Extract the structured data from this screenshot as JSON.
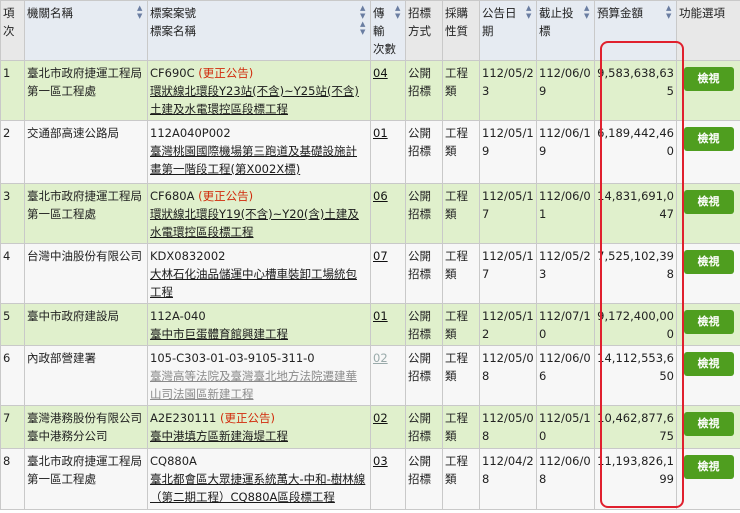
{
  "headers": {
    "idx": "項次",
    "agency": "機關名稱",
    "case_line1": "標案案號",
    "case_line2": "標案名稱",
    "freq": "傳輸次數",
    "method": "招標方式",
    "category": "採購性質",
    "announce": "公告日期",
    "deadline": "截止投標",
    "budget": "預算金額",
    "action": "功能選項"
  },
  "view_button_label": "檢視",
  "rows": [
    {
      "idx": "1",
      "agency": "臺北市政府捷運工程局第一區工程處",
      "case_no": "CF690C",
      "notice": "(更正公告)",
      "case_name": "環狀線北環段Y23站(不含)~Y25站(不含)土建及水電環控區段標工程",
      "freq": "04",
      "method": "公開招標",
      "category": "工程類",
      "announce": "112/05/23",
      "deadline": "112/06/09",
      "budget": "9,583,638,635"
    },
    {
      "idx": "2",
      "agency": "交通部高速公路局",
      "case_no": "112A040P002",
      "notice": "",
      "case_name": "臺灣桃園國際機場第三跑道及基礎設施計畫第一階段工程(第X002X標)",
      "freq": "01",
      "method": "公開招標",
      "category": "工程類",
      "announce": "112/05/19",
      "deadline": "112/06/19",
      "budget": "6,189,442,460"
    },
    {
      "idx": "3",
      "agency": "臺北市政府捷運工程局第一區工程處",
      "case_no": "CF680A",
      "notice": "(更正公告)",
      "case_name": "環狀線北環段Y19(不含)~Y20(含)土建及水電環控區段標工程",
      "freq": "06",
      "method": "公開招標",
      "category": "工程類",
      "announce": "112/05/17",
      "deadline": "112/06/01",
      "budget": "14,831,691,047"
    },
    {
      "idx": "4",
      "agency": "台灣中油股份有限公司",
      "case_no": "KDX0832002",
      "notice": "",
      "case_name": "大林石化油品儲運中心槽車裝卸工場統包工程",
      "freq": "07",
      "method": "公開招標",
      "category": "工程類",
      "announce": "112/05/17",
      "deadline": "112/05/23",
      "budget": "7,525,102,398"
    },
    {
      "idx": "5",
      "agency": "臺中市政府建設局",
      "case_no": "112A-040",
      "notice": "",
      "case_name": "臺中市巨蛋體育館興建工程",
      "freq": "01",
      "method": "公開招標",
      "category": "工程類",
      "announce": "112/05/12",
      "deadline": "112/07/10",
      "budget": "9,172,400,000"
    },
    {
      "idx": "6",
      "agency": "內政部營建署",
      "case_no": "105-C303-01-03-9105-311-0",
      "notice": "",
      "case_name": "臺灣高等法院及臺灣臺北地方法院遷建華山司法園區新建工程",
      "freq": "02",
      "method": "公開招標",
      "category": "工程類",
      "announce": "112/05/08",
      "deadline": "112/06/06",
      "budget": "14,112,553,650"
    },
    {
      "idx": "7",
      "agency": "臺灣港務股份有限公司臺中港務分公司",
      "case_no": "A2E230111",
      "notice": "(更正公告)",
      "case_name": "臺中港填方區新建海堤工程",
      "freq": "02",
      "method": "公開招標",
      "category": "工程類",
      "announce": "112/05/08",
      "deadline": "112/05/10",
      "budget": "10,462,877,675"
    },
    {
      "idx": "8",
      "agency": "臺北市政府捷運工程局第一區工程處",
      "case_no": "CQ880A",
      "notice": "",
      "case_name": "臺北都會區大眾捷運系統萬大-中和-樹林線（第二期工程）CQ880A區段標工程",
      "freq": "03",
      "method": "公開招標",
      "category": "工程類",
      "announce": "112/04/28",
      "deadline": "112/06/08",
      "budget": "11,193,826,199"
    }
  ]
}
